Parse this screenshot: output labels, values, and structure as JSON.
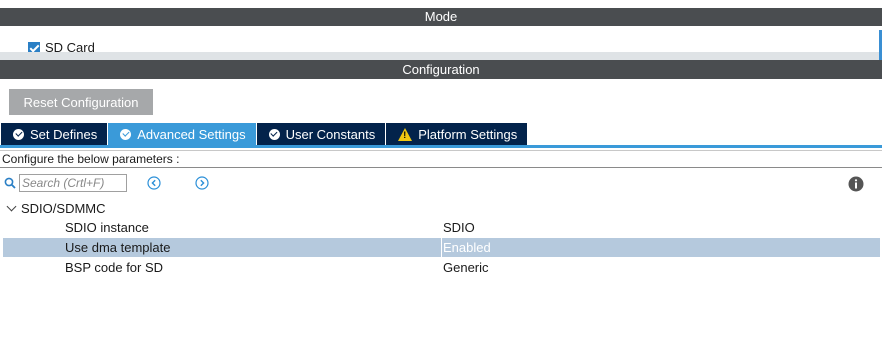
{
  "mode": {
    "title": "Mode",
    "sd_card_label": "SD Card",
    "sd_card_checked": true
  },
  "configuration": {
    "title": "Configuration",
    "reset_label": "Reset Configuration"
  },
  "tabs": [
    {
      "label": "Set Defines",
      "icon": "check-circle-icon",
      "active": false
    },
    {
      "label": "Advanced Settings",
      "icon": "check-circle-icon",
      "active": true
    },
    {
      "label": "User Constants",
      "icon": "check-circle-icon",
      "active": false
    },
    {
      "label": "Platform Settings",
      "icon": "warning-icon",
      "active": false
    }
  ],
  "params": {
    "header": "Configure the below parameters :",
    "search_placeholder": "Search (Crtl+F)",
    "group": "SDIO/SDMMC",
    "rows": [
      {
        "name": "SDIO instance",
        "value": "SDIO"
      },
      {
        "name": "Use dma template",
        "value": "Enabled"
      },
      {
        "name": "BSP code for SD",
        "value": "Generic"
      }
    ]
  },
  "colors": {
    "header_bar": "#4a4d50",
    "tab_inactive": "#03234b",
    "tab_active": "#3a9ad9",
    "selected_row": "#b5c9dd"
  }
}
